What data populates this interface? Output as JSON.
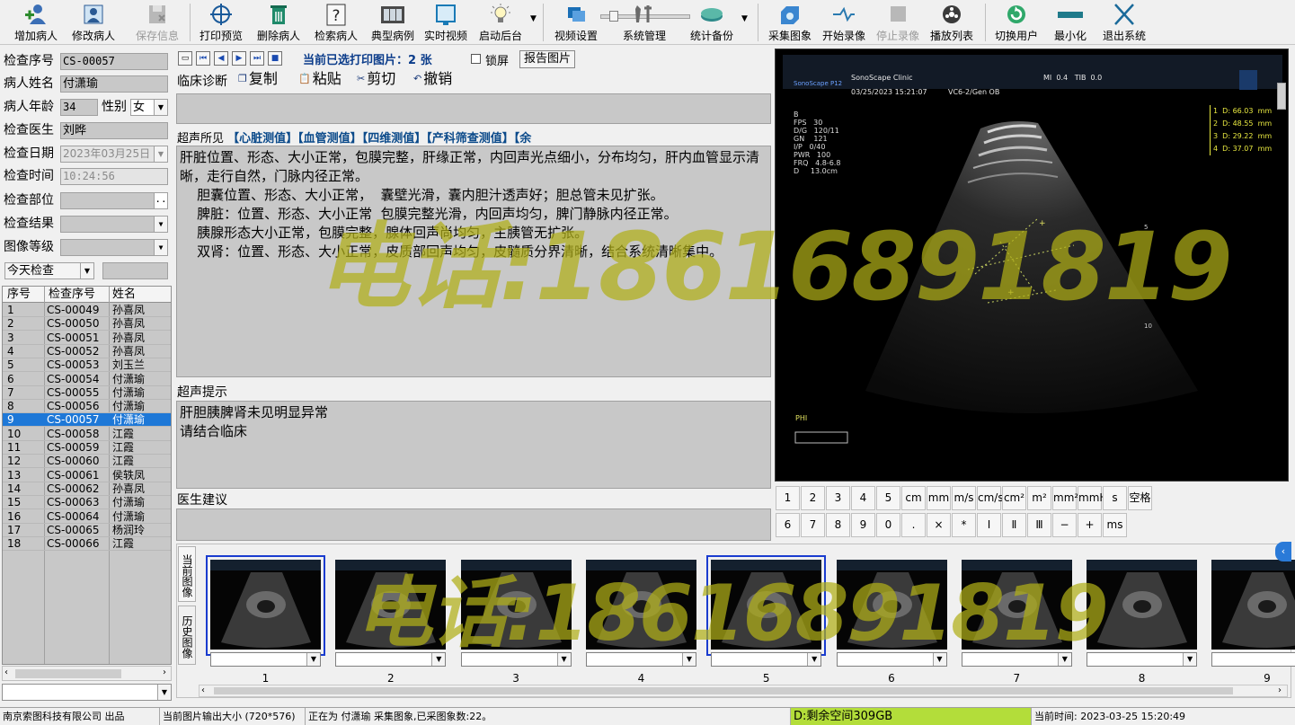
{
  "toolbar": {
    "add_patient": "增加病人",
    "edit_patient": "修改病人",
    "save_info": "保存信息",
    "print_preview": "打印预览",
    "delete_patient": "删除病人",
    "search_patient": "检索病人",
    "typical_case": "典型病例",
    "live_video": "实时视频",
    "start_backend": "启动后台",
    "video_settings": "视频设置",
    "system_management": "系统管理",
    "stats_backup": "统计备份",
    "capture_image": "采集图象",
    "start_recording": "开始录像",
    "stop_recording": "停止录像",
    "playlist": "播放列表",
    "switch_user": "切换用户",
    "minimize": "最小化",
    "exit_system": "退出系统"
  },
  "patient_form": {
    "exam_no_label": "检查序号",
    "exam_no": "CS-00057",
    "name_label": "病人姓名",
    "name": "付潇瑜",
    "age_label": "病人年龄",
    "age": "34",
    "sex_label": "性别",
    "sex": "女",
    "doctor_label": "检查医生",
    "doctor": "刘晔",
    "date_label": "检查日期",
    "date": "2023年03月25日",
    "time_label": "检查时间",
    "time": "10:24:56",
    "part_label": "检查部位",
    "part_btn": "..",
    "result_label": "检查结果",
    "grade_label": "图像等级",
    "filter": "今天检查"
  },
  "patient_table": {
    "col_index": "序号",
    "col_exam": "检查序号",
    "col_name": "姓名",
    "rows": [
      {
        "i": "1",
        "no": "CS-00049",
        "name": "孙喜凤"
      },
      {
        "i": "2",
        "no": "CS-00050",
        "name": "孙喜凤"
      },
      {
        "i": "3",
        "no": "CS-00051",
        "name": "孙喜凤"
      },
      {
        "i": "4",
        "no": "CS-00052",
        "name": "孙喜凤"
      },
      {
        "i": "5",
        "no": "CS-00053",
        "name": "刘玉兰"
      },
      {
        "i": "6",
        "no": "CS-00054",
        "name": "付潇瑜"
      },
      {
        "i": "7",
        "no": "CS-00055",
        "name": "付潇瑜"
      },
      {
        "i": "8",
        "no": "CS-00056",
        "name": "付潇瑜"
      },
      {
        "i": "9",
        "no": "CS-00057",
        "name": "付潇瑜"
      },
      {
        "i": "10",
        "no": "CS-00058",
        "name": "江霞"
      },
      {
        "i": "11",
        "no": "CS-00059",
        "name": "江霞"
      },
      {
        "i": "12",
        "no": "CS-00060",
        "name": "江霞"
      },
      {
        "i": "13",
        "no": "CS-00061",
        "name": "侯轶凤"
      },
      {
        "i": "14",
        "no": "CS-00062",
        "name": "孙喜凤"
      },
      {
        "i": "15",
        "no": "CS-00063",
        "name": "付潇瑜"
      },
      {
        "i": "16",
        "no": "CS-00064",
        "name": "付潇瑜"
      },
      {
        "i": "17",
        "no": "CS-00065",
        "name": "杨润玲"
      },
      {
        "i": "18",
        "no": "CS-00066",
        "name": "江霞"
      }
    ],
    "selected_index": 8
  },
  "report": {
    "print_count_text": "当前已选打印图片：2 张",
    "lock_label": "锁屏",
    "report_image_btn": "报告图片",
    "clinical_label": "临床诊断",
    "copy": "复制",
    "paste": "粘贴",
    "cut": "剪切",
    "undo": "撤销",
    "findings_label": "超声所见",
    "links": [
      "【心脏测值】",
      "【血管测值】",
      "【四维测值】",
      "【产科筛查测值】",
      "【余"
    ],
    "findings_text": "肝脏位置、形态、大小正常，包膜完整，肝缘正常，内回声光点细小，分布均匀，肝内血管显示清晰，走行自然，门脉内径正常。\n    胆囊位置、形态、大小正常，  囊壁光滑，囊内胆汁透声好；胆总管未见扩张。\n    脾脏：位置、形态、大小正常  包膜完整光滑，内回声均匀，脾门静脉内径正常。\n    胰腺形态大小正常，包膜完整，腺体回声尚均匀，主胰管无扩张。\n    双肾：位置、形态、大小正常，皮质部回声均匀，皮髓质分界清晰，结合系统清晰集中。",
    "hint_label": "超声提示",
    "hint_text": "肝胆胰脾肾未见明显异常\n请结合临床",
    "advice_label": "医生建议"
  },
  "ultrasound": {
    "brand": "SonoScape P12",
    "clinic": "SonoScape Clinic",
    "datetime": "03/25/2023 15:21:07",
    "probe": "VC6-2/Gen OB",
    "mi": "MI  0.4   TIB  0.0",
    "params": [
      "B",
      "FPS   30",
      "D/G   120/11",
      "GN    121",
      "I/P   0/40",
      "PWR   100",
      "FRQ   4.8-6.8",
      "D     13.0cm"
    ],
    "measures": [
      "1  D: 66.03  mm",
      "2  D: 48.55  mm",
      "3  D: 29.22  mm",
      "4  D: 37.07  mm"
    ],
    "scale_marks": [
      "5",
      "10"
    ],
    "phi": "PHI"
  },
  "keypad": {
    "row1": [
      "1",
      "2",
      "3",
      "4",
      "5",
      "cm",
      "mm",
      "m/s",
      "cm/s",
      "cm²",
      "m²",
      "mm²",
      "mmHg",
      "s",
      "空格"
    ],
    "row2": [
      "6",
      "7",
      "8",
      "9",
      "0",
      ".",
      "×",
      "*",
      "Ⅰ",
      "Ⅱ",
      "Ⅲ",
      "−",
      "+",
      "ms"
    ]
  },
  "thumbnails": {
    "tab_current": "当前图像",
    "tab_history": "历史图像",
    "items": [
      "1",
      "2",
      "3",
      "4",
      "5",
      "6",
      "7",
      "8",
      "9"
    ],
    "selected": [
      0,
      4
    ]
  },
  "watermark": {
    "text1": "电话:18616891819",
    "text2": "电话:18616891819"
  },
  "status": {
    "company": "南京索图科技有限公司 出品",
    "output_size": "当前图片输出大小 (720*576)",
    "capture": "正在为 付潇瑜 采集图象,已采图象数:22。",
    "disk": "D:剩余空间309GB",
    "current_time": "当前时间: 2023-03-25 15:20:49"
  },
  "colors": {
    "selection": "#1e78d7",
    "field_bg": "#c8c8c8",
    "link": "#0b4a8a",
    "disk_bg": "#b3dd3a",
    "watermark": "#b0ae18"
  }
}
